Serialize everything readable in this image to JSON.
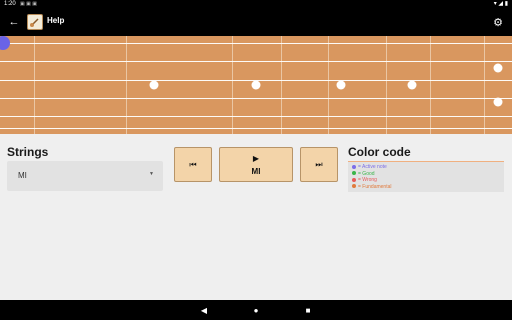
{
  "status_bar": {
    "time": "1:20"
  },
  "app_bar": {
    "title": "Help"
  },
  "strings_section": {
    "title": "Strings",
    "selected": "MI"
  },
  "controls": {
    "prev_glyph": "⏮",
    "play_glyph": "▶",
    "play_label": "MI",
    "next_glyph": "⏭"
  },
  "legend": {
    "title": "Color code",
    "items": [
      {
        "label": "= Active note",
        "color": "#7b6ee8"
      },
      {
        "label": "= Good",
        "color": "#3ab54a"
      },
      {
        "label": "= Wrong",
        "color": "#e75b5b"
      },
      {
        "label": "= Fundamental",
        "color": "#e07a3c"
      }
    ]
  }
}
